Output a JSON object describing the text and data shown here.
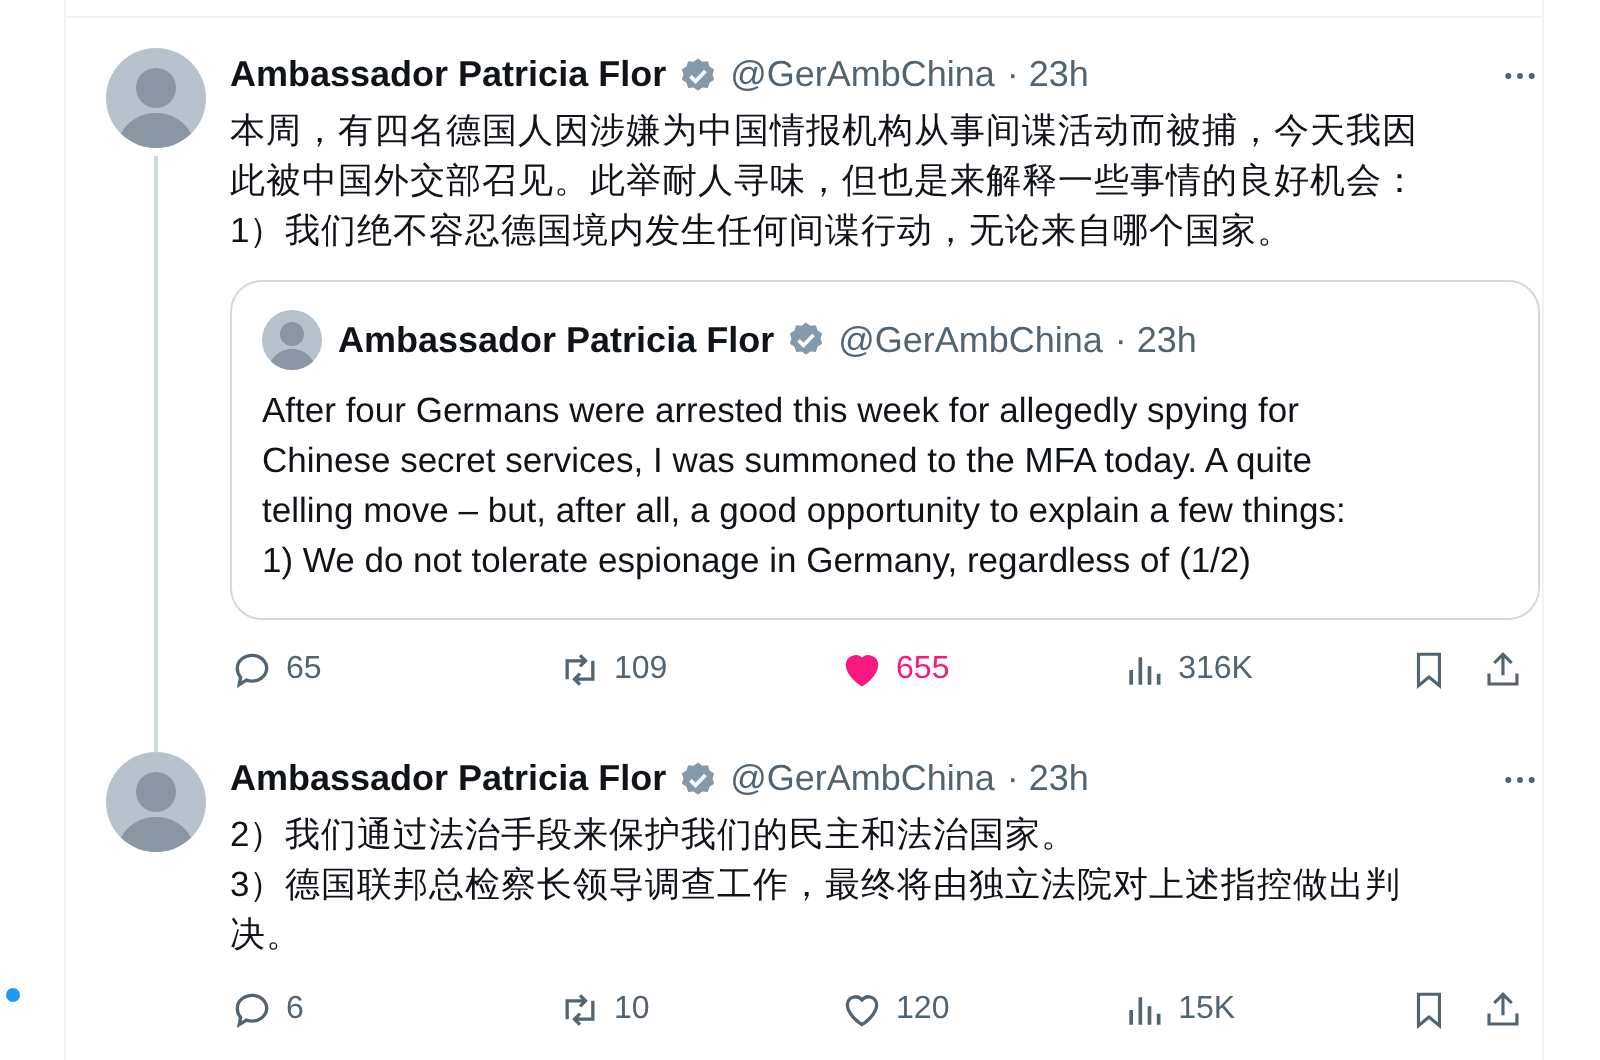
{
  "tweets": [
    {
      "author": "Ambassador Patricia Flor",
      "verified": true,
      "handle": "@GerAmbChina",
      "time": "· 23h",
      "thread_continues": true,
      "lines": [
        "本周，有四名德国人因涉嫌为中国情报机构从事间谍活动而被捕，今天我因",
        "此被中国外交部召见。此举耐人寻味，但也是来解释一些事情的良好机会：",
        "1）我们绝不容忍德国境内发生任何间谍行动，无论来自哪个国家。"
      ],
      "quote": {
        "author": "Ambassador Patricia Flor",
        "verified": true,
        "handle": "@GerAmbChina",
        "time": "· 23h",
        "lines": [
          "After four Germans were arrested this week for allegedly spying for",
          "Chinese secret services, I was summoned to the MFA today. A quite",
          "telling move – but, after all, a good opportunity to explain a few things:",
          "1) We do not tolerate espionage in Germany, regardless of (1/2)"
        ]
      },
      "replies": "65",
      "reposts": "109",
      "likes": "655",
      "liked": true,
      "views": "316K"
    },
    {
      "author": "Ambassador Patricia Flor",
      "verified": true,
      "handle": "@GerAmbChina",
      "time": "· 23h",
      "thread_continues": false,
      "lines": [
        "2）我们通过法治手段来保护我们的民主和法治国家。",
        "3）德国联邦总检察长领导调查工作，最终将由独立法院对上述指控做出判",
        "决。"
      ],
      "replies": "6",
      "reposts": "10",
      "likes": "120",
      "liked": false,
      "views": "15K"
    }
  ]
}
